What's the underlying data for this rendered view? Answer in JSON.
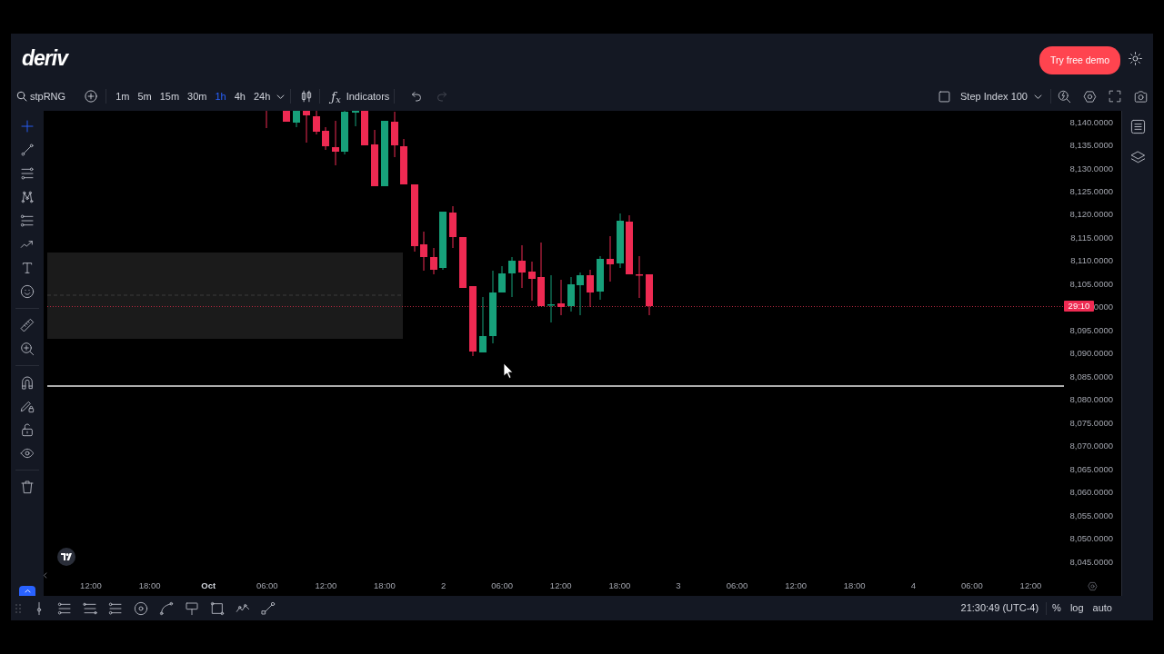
{
  "header": {
    "logo": "deriv",
    "demo_button": "Try free demo"
  },
  "toolbar": {
    "symbol": "stpRNG",
    "timeframes": [
      {
        "label": "1m",
        "selected": false
      },
      {
        "label": "5m",
        "selected": false
      },
      {
        "label": "15m",
        "selected": false
      },
      {
        "label": "30m",
        "selected": false
      },
      {
        "label": "1h",
        "selected": true
      },
      {
        "label": "4h",
        "selected": false
      },
      {
        "label": "24h",
        "selected": false
      }
    ],
    "indicators": {
      "icon": "ƒ$_{x}$",
      "label": "Indicators"
    },
    "history": [
      {
        "disabled": false
      },
      {
        "disabled": true
      }
    ],
    "market": "Step Index 100"
  },
  "drawing_tools": [
    {
      "selected": true
    },
    {
      "selected": false
    },
    {
      "selected": false
    },
    {
      "selected": false
    },
    {
      "selected": false
    },
    {
      "selected": false
    },
    {
      "selected": false
    },
    {
      "selected": false
    },
    {
      "selected": false
    },
    {
      "selected": false
    },
    {
      "selected": false
    },
    {
      "selected": false
    },
    {
      "selected": false
    },
    {
      "selected": false
    },
    {
      "selected": false
    }
  ],
  "chart": {
    "price_axis": [
      "8,140.0000",
      "8,135.0000",
      "8,130.0000",
      "8,125.0000",
      "8,120.0000",
      "8,115.0000",
      "8,110.0000",
      "8,105.0000",
      "0000",
      "8,095.0000",
      "8,090.0000",
      "8,085.0000",
      "8,080.0000",
      "8,075.0000",
      "8,070.0000",
      "8,065.0000",
      "8,060.0000",
      "8,055.0000",
      "8,050.0000",
      "8,045.0000"
    ],
    "countdown": "29:10",
    "time_axis": [
      {
        "label": "12:00",
        "kind": "time"
      },
      {
        "label": "18:00",
        "kind": "time"
      },
      {
        "label": "Oct",
        "kind": "month"
      },
      {
        "label": "06:00",
        "kind": "time"
      },
      {
        "label": "12:00",
        "kind": "time"
      },
      {
        "label": "18:00",
        "kind": "time"
      },
      {
        "label": "2",
        "kind": "day"
      },
      {
        "label": "06:00",
        "kind": "time"
      },
      {
        "label": "12:00",
        "kind": "time"
      },
      {
        "label": "18:00",
        "kind": "time"
      },
      {
        "label": "3",
        "kind": "day"
      },
      {
        "label": "06:00",
        "kind": "time"
      },
      {
        "label": "12:00",
        "kind": "time"
      },
      {
        "label": "18:00",
        "kind": "time"
      },
      {
        "label": "4",
        "kind": "day"
      },
      {
        "label": "06:00",
        "kind": "time"
      },
      {
        "label": "12:00",
        "kind": "time"
      }
    ]
  },
  "status_bar": {
    "clock": "21:30:49 (UTC-4)",
    "scale_options": [
      "%",
      "log",
      "auto"
    ]
  }
}
